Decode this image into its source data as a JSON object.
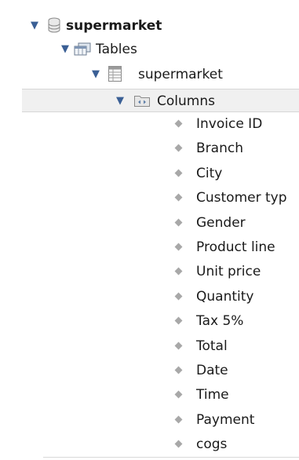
{
  "tree": {
    "database": {
      "label": "supermarket",
      "icon": "database-icon",
      "expanded": true
    },
    "tables_folder": {
      "label": "Tables",
      "icon": "tables-folder-icon",
      "expanded": true
    },
    "table": {
      "label": "supermarket",
      "icon": "table-icon",
      "expanded": true
    },
    "columns_folder": {
      "label": "Columns",
      "icon": "columns-folder-icon",
      "expanded": true,
      "selected": true
    },
    "columns": [
      "Invoice ID",
      "Branch",
      "City",
      "Customer typ",
      "Gender",
      "Product line",
      "Unit price",
      "Quantity",
      "Tax 5%",
      "Total",
      "Date",
      "Time",
      "Payment",
      "cogs"
    ]
  },
  "colors": {
    "toggle_arrow": "#3a5f95",
    "selected_row_bg": "#f0f0f0",
    "column_diamond": "#a8a8a8"
  }
}
